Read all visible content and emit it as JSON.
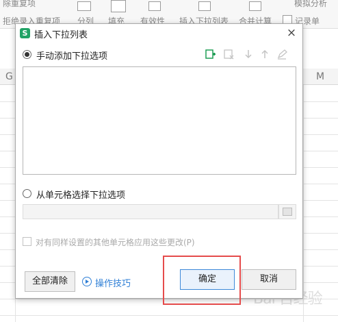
{
  "ribbon": {
    "texts": [
      "除重复项",
      "拒绝录入重复项",
      "分列",
      "填充",
      "有效性",
      "插入下拉列表",
      "合并计算",
      "记录单",
      "模拟分析"
    ]
  },
  "sheet": {
    "columns": [
      "G",
      "M"
    ]
  },
  "dialog": {
    "title": "插入下拉列表",
    "close_glyph": "×",
    "manual_label": "手动添加下拉选项",
    "cell_select_label": "从单元格选择下拉选项",
    "apply_label": "对有同样设置的其他单元格应用这些更改(P)",
    "clear_all_label": "全部清除",
    "help_label": "操作技巧",
    "ok_label": "确定",
    "cancel_label": "取消",
    "list_items": [],
    "range_value": "",
    "apply_checked": false,
    "manual_selected": true,
    "toolbar_icons": [
      "add-item-icon",
      "delete-item-icon",
      "move-down-icon",
      "move-up-icon",
      "edit-item-icon"
    ]
  },
  "colors": {
    "logo": "#21a366",
    "highlight": "#e54b4b",
    "link": "#2f7fd6",
    "add_icon": "#1f9d55"
  },
  "watermark": "Bai 百经验"
}
